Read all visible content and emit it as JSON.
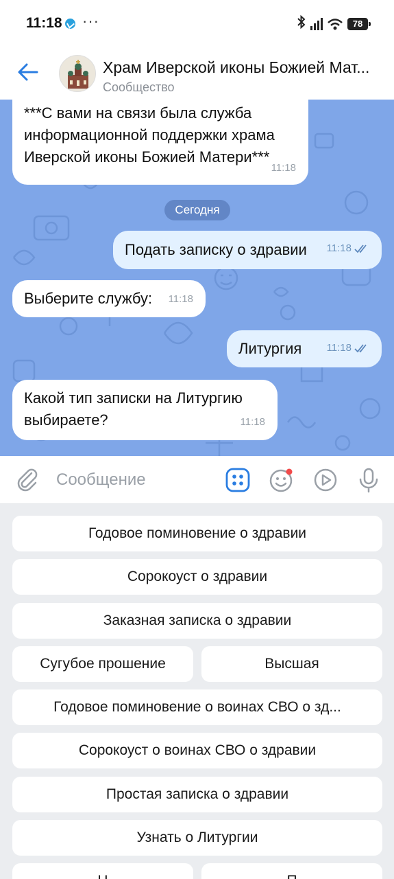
{
  "status_bar": {
    "time": "11:18",
    "more": "···",
    "battery": "78"
  },
  "header": {
    "title": "Храм Иверской иконы Божией Мат...",
    "subtitle": "Сообщество"
  },
  "chat": {
    "date_label": "Сегодня",
    "messages": [
      {
        "direction": "in",
        "text": "***С вами на связи была служба информационной поддержки храма Иверской иконы Божией Матери***",
        "time": "11:18"
      },
      {
        "direction": "out",
        "text": "Подать записку о здравии",
        "time": "11:18"
      },
      {
        "direction": "in",
        "text": "Выберите службу:",
        "time": "11:18"
      },
      {
        "direction": "out",
        "text": "Литургия",
        "time": "11:18"
      },
      {
        "direction": "in",
        "text": "Какой тип записки на Литургию выбираете?",
        "time": "11:18"
      }
    ]
  },
  "composer": {
    "placeholder": "Сообщение"
  },
  "keyboard": {
    "buttons": [
      "Годовое поминовение о здравии",
      "Сорокоуст о здравии",
      "Заказная записка о здравии",
      "Сугубое прошение",
      "Высшая",
      "Годовое поминовение о воинах СВО о зд...",
      "Сорокоуст о воинах СВО о здравии",
      "Простая записка о здравии",
      "Узнать о Литургии",
      "Н",
      "П"
    ]
  },
  "colors": {
    "accent": "#2a7de1",
    "chat_bg": "#7fa6e8",
    "outgoing_bubble": "#e3f1ff",
    "keyboard_bg": "#ebedf0"
  },
  "icons": [
    "telegram-icon",
    "bluetooth-icon",
    "signal-icon",
    "wifi-icon",
    "battery-icon",
    "back-arrow-icon",
    "attach-icon",
    "bot-keyboard-icon",
    "emoji-icon",
    "video-message-icon",
    "microphone-icon",
    "double-check-icon"
  ]
}
